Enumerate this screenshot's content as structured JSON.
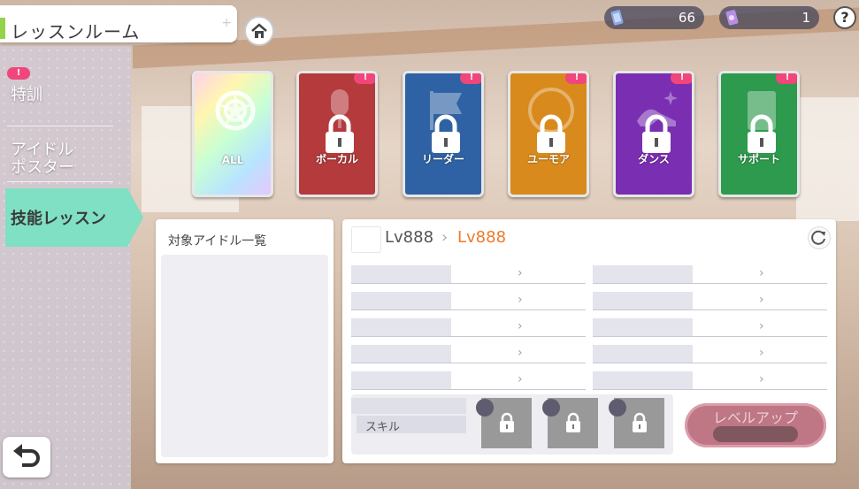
{
  "header": {
    "title": "レッスンルーム"
  },
  "currency": [
    {
      "icon": "ticket-icon",
      "value": "66"
    },
    {
      "icon": "gem-ticket-icon",
      "value": "1"
    }
  ],
  "help_label": "?",
  "sidebar": {
    "items": [
      {
        "label": "特訓",
        "badge": "!"
      },
      {
        "label": "アイドル\nポスター"
      },
      {
        "label": "技能レッスン",
        "active": true
      }
    ]
  },
  "badge_text": "!",
  "cards": [
    {
      "label": "ALL",
      "locked": false,
      "color": "#e8f4ff"
    },
    {
      "label": "ボーカル",
      "locked": true,
      "color": "#b43a3c",
      "badge": "!"
    },
    {
      "label": "リーダー",
      "locked": true,
      "color": "#2f62a4",
      "badge": "!"
    },
    {
      "label": "ユーモア",
      "locked": true,
      "color": "#d88a1c",
      "badge": "!"
    },
    {
      "label": "ダンス",
      "locked": true,
      "color": "#7a2fb2",
      "badge": "!"
    },
    {
      "label": "サポート",
      "locked": true,
      "color": "#2e9a4d",
      "badge": "!"
    }
  ],
  "left_panel": {
    "title": "対象アイドル一覧"
  },
  "right_panel": {
    "level_from": "Lv888",
    "level_to": "Lv888",
    "skill_label": "スキル",
    "levelup_label": "レベルアップ"
  },
  "colors": {
    "accent_green": "#93d34a",
    "active_tab": "#7fe0c3",
    "levelup": "#b45f70",
    "level_to": "#ef7a2a"
  }
}
